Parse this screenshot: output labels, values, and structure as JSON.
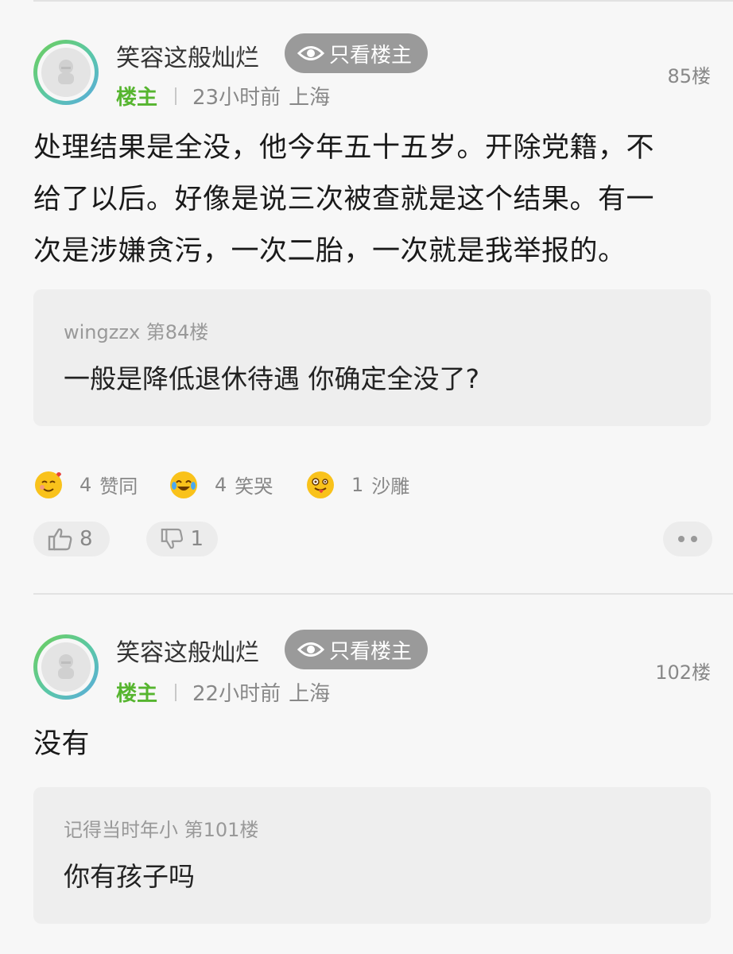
{
  "posts": [
    {
      "username": "笑容这般灿烂",
      "only_op_label": "只看楼主",
      "op_tag": "楼主",
      "time": "23小时前",
      "location": "上海",
      "floor": "85楼",
      "content_lines": [
        "处理结果是全没，他今年五十五岁。开除党籍，不",
        "给了以后。好像是说三次被查就是这个结果。有一",
        "次是涉嫌贪污，一次二胎，一次就是我举报的。"
      ],
      "quote": {
        "author": "wingzzx 第84楼",
        "text": "一般是降低退休待遇 你确定全没了?"
      },
      "reactions": [
        {
          "icon": "love-face-emoji-icon",
          "count": "4",
          "label": "赞同"
        },
        {
          "icon": "tears-of-joy-emoji-icon",
          "count": "4",
          "label": "笑哭"
        },
        {
          "icon": "silly-face-emoji-icon",
          "count": "1",
          "label": "沙雕"
        }
      ],
      "like_count": "8",
      "dislike_count": "1"
    },
    {
      "username": "笑容这般灿烂",
      "only_op_label": "只看楼主",
      "op_tag": "楼主",
      "time": "22小时前",
      "location": "上海",
      "floor": "102楼",
      "content": "没有",
      "quote": {
        "author": "记得当时年小 第101楼",
        "text": "你有孩子吗"
      }
    }
  ],
  "colors": {
    "op_green": "#56b52f",
    "pill_gray": "#9a9a9a",
    "emoji_yellow": "#f9c21b"
  }
}
